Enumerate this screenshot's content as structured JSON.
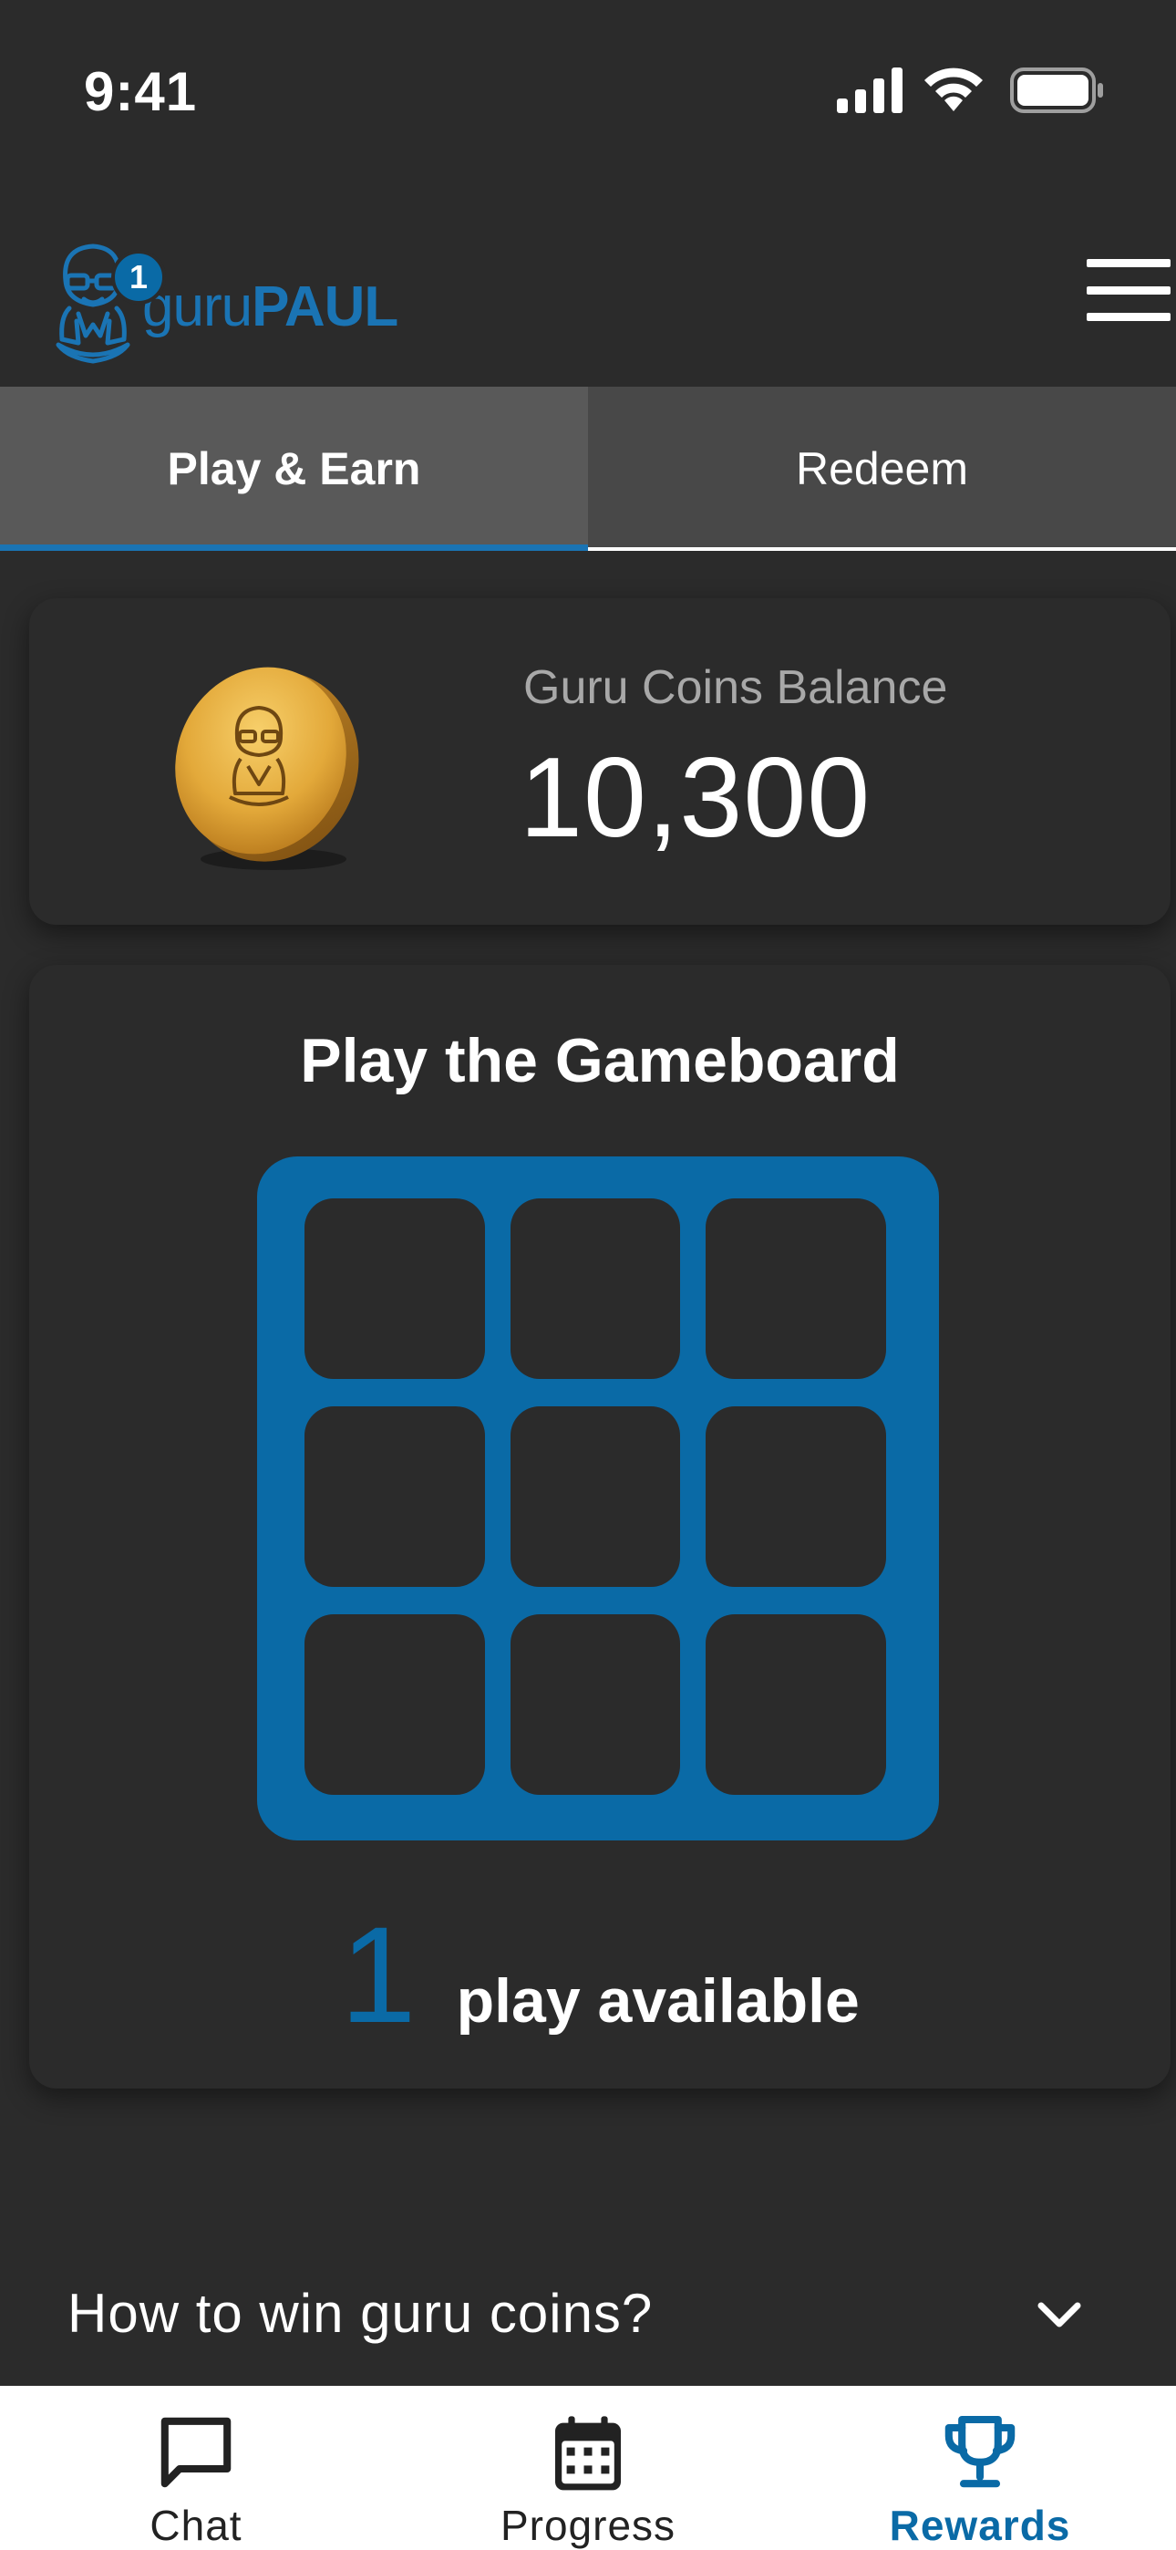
{
  "status_bar": {
    "time": "9:41",
    "icons": [
      "cellular-signal-icon",
      "wifi-icon",
      "battery-icon"
    ]
  },
  "header": {
    "logo_text_light": "guru",
    "logo_text_bold": "PAUL",
    "notification_count": "1",
    "menu_icon": "hamburger-menu-icon"
  },
  "tabs": [
    {
      "label": "Play & Earn",
      "active": true
    },
    {
      "label": "Redeem",
      "active": false
    }
  ],
  "balance": {
    "label": "Guru Coins Balance",
    "value": "10,300",
    "icon": "gold-coin-icon"
  },
  "gameboard": {
    "title": "Play the Gameboard",
    "cells": 9,
    "plays_count": "1",
    "plays_label": "play available"
  },
  "faq": {
    "label": "How to win guru coins?",
    "icon": "chevron-down-icon"
  },
  "bottom_nav": [
    {
      "label": "Chat",
      "icon": "chat-bubble-icon",
      "active": false
    },
    {
      "label": "Progress",
      "icon": "calendar-icon",
      "active": false
    },
    {
      "label": "Rewards",
      "icon": "trophy-icon",
      "active": true
    }
  ],
  "colors": {
    "background": "#2b2b2b",
    "accent": "#0a6aa6",
    "logo_blue": "#1a74b4",
    "tab_bar": "#484848",
    "nav_background": "#ffffff",
    "coin_gold": "#e3a93a"
  }
}
